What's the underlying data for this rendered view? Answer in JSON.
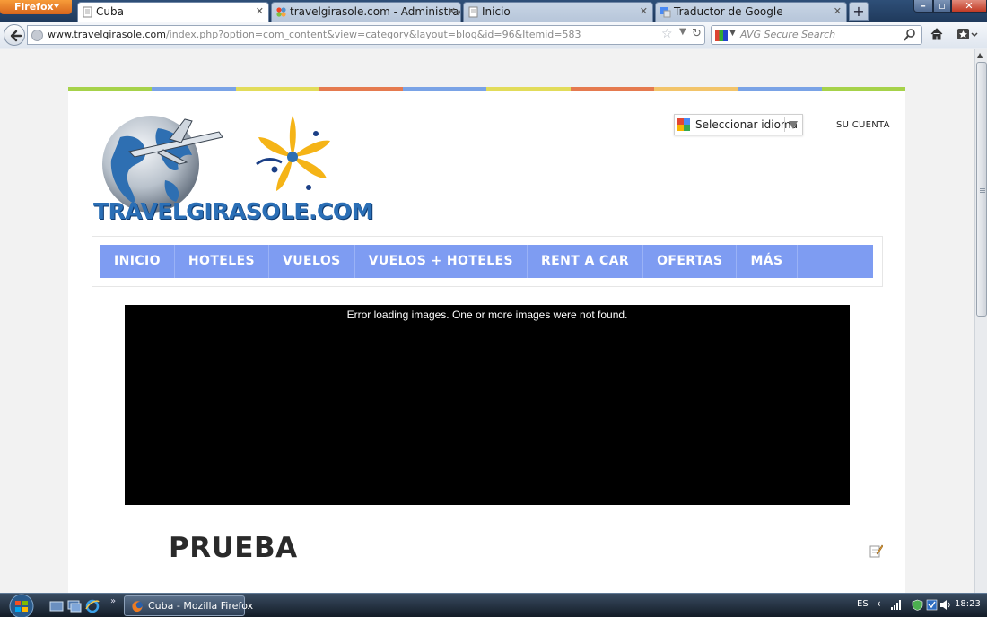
{
  "browser": {
    "app_button": "Firefox",
    "tabs": [
      {
        "title": "Cuba",
        "active": true
      },
      {
        "title": "travelgirasole.com - Administración",
        "active": false
      },
      {
        "title": "Inicio",
        "active": false
      },
      {
        "title": "Traductor de Google",
        "active": false
      }
    ],
    "new_tab": "+",
    "url_domain": "www.travelgirasole.com",
    "url_path": "/index.php?option=com_content&view=category&layout=blog&id=96&Itemid=583",
    "search_placeholder": "AVG Secure Search"
  },
  "site": {
    "logo_text": "TRAVELGIRASOLE.COM",
    "language_select": "Seleccionar idioma",
    "account_link": "SU CUENTA",
    "menu": [
      "INICIO",
      "HOTELES",
      "VUELOS",
      "VUELOS + HOTELES",
      "RENT A CAR",
      "OFERTAS",
      "MÁS"
    ],
    "slideshow_error": "Error loading images. One or more images were not found.",
    "article_title": "PRUEBA",
    "colors": {
      "menu_bg": "#7e9cf2",
      "stripe": [
        "#a6d24a",
        "#7aa3e6",
        "#e2dc5a",
        "#e57a4f",
        "#7aa3e6",
        "#e2dc5a",
        "#e57a4f",
        "#f2c46a",
        "#7aa3e6",
        "#a6d24a"
      ]
    }
  },
  "taskbar": {
    "window_button": "Cuba - Mozilla Firefox",
    "language": "ES",
    "clock": "18:23"
  }
}
